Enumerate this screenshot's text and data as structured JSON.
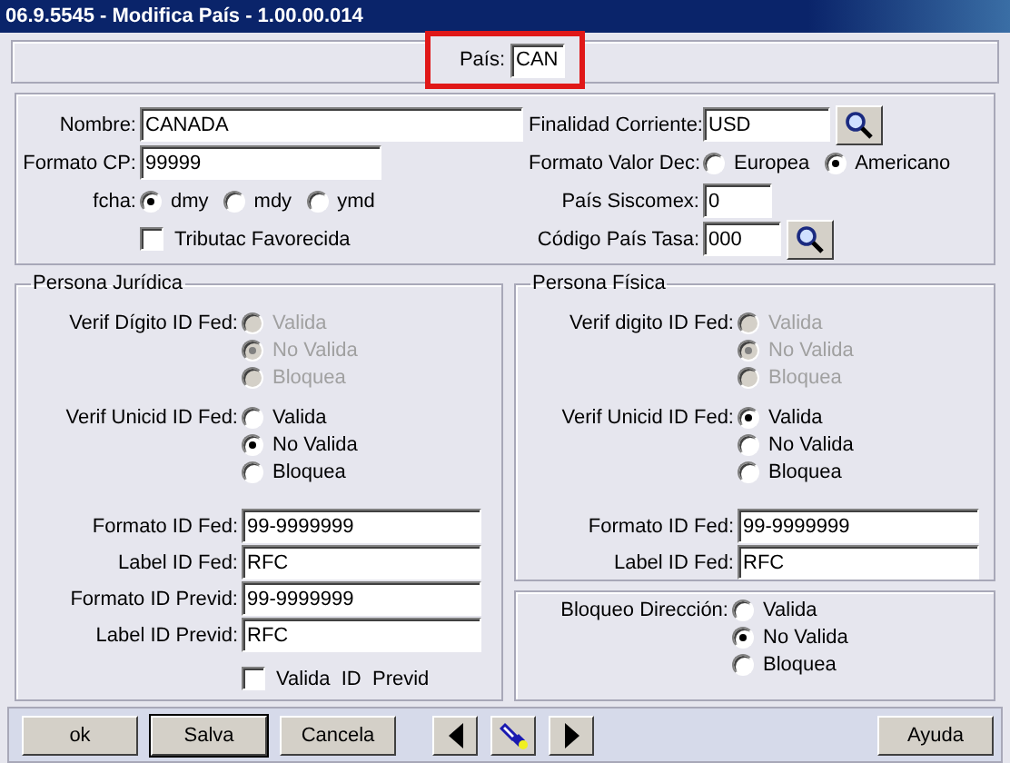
{
  "window": {
    "title": "06.9.5545 - Modifica País - 1.00.00.014"
  },
  "pais": {
    "label": "País:",
    "value": "CAN",
    "highlighted": true
  },
  "general": {
    "nombre": {
      "label": "Nombre:",
      "value": "CANADA"
    },
    "formato_cp": {
      "label": "Formato CP:",
      "value": "99999"
    },
    "fecha": {
      "label": "fcha:",
      "disabled": false,
      "options": [
        {
          "label": "dmy",
          "selected": true
        },
        {
          "label": "mdy",
          "selected": false
        },
        {
          "label": "ymd",
          "selected": false
        }
      ]
    },
    "tributac": {
      "label": "Tributac Favorecida",
      "checked": false
    },
    "finalidad": {
      "label": "Finalidad Corriente:",
      "value": "USD"
    },
    "formato_valor": {
      "label": "Formato Valor Dec:",
      "disabled": false,
      "options": [
        {
          "label": "Europea",
          "selected": false
        },
        {
          "label": "Americano",
          "selected": true
        }
      ]
    },
    "siscomex": {
      "label": "País Siscomex:",
      "value": "0"
    },
    "codigo_tasa": {
      "label": "Código País Tasa:",
      "value": "000"
    }
  },
  "juridica": {
    "title": "Persona Jurídica",
    "verif_digito": {
      "label": "Verif Dígito ID Fed:",
      "disabled": true,
      "options": [
        {
          "label": "Valida",
          "selected": false
        },
        {
          "label": "No Valida",
          "selected": true
        },
        {
          "label": "Bloquea",
          "selected": false
        }
      ]
    },
    "verif_unicid": {
      "label": "Verif Unicid ID Fed:",
      "disabled": false,
      "options": [
        {
          "label": "Valida",
          "selected": false
        },
        {
          "label": "No Valida",
          "selected": true
        },
        {
          "label": "Bloquea",
          "selected": false
        }
      ]
    },
    "fields": [
      {
        "label": "Formato ID Fed:",
        "value": "99-9999999"
      },
      {
        "label": "Label ID Fed:",
        "value": "RFC"
      },
      {
        "label": "Formato ID Previd:",
        "value": "99-9999999"
      },
      {
        "label": "Label ID Previd:",
        "value": "RFC"
      }
    ],
    "valida_previd": {
      "label": "Valida  ID  Previd",
      "checked": false
    }
  },
  "fisica": {
    "title": "Persona Física",
    "verif_digito": {
      "label": "Verif digito ID Fed:",
      "disabled": true,
      "options": [
        {
          "label": "Valida",
          "selected": false
        },
        {
          "label": "No Valida",
          "selected": true
        },
        {
          "label": "Bloquea",
          "selected": false
        }
      ]
    },
    "verif_unicid": {
      "label": "Verif Unicid ID Fed:",
      "disabled": false,
      "options": [
        {
          "label": "Valida",
          "selected": true
        },
        {
          "label": "No Valida",
          "selected": false
        },
        {
          "label": "Bloquea",
          "selected": false
        }
      ]
    },
    "fields": [
      {
        "label": "Formato ID Fed:",
        "value": "99-9999999"
      },
      {
        "label": "Label ID Fed:",
        "value": "RFC"
      }
    ]
  },
  "bloqueo": {
    "label": "Bloqueo Dirección:",
    "disabled": false,
    "options": [
      {
        "label": "Valida",
        "selected": false
      },
      {
        "label": "No Valida",
        "selected": true
      },
      {
        "label": "Bloquea",
        "selected": false
      }
    ]
  },
  "buttons": [
    {
      "kind": "text",
      "label": "ok",
      "default": false
    },
    {
      "kind": "text",
      "label": "Salva",
      "default": true
    },
    {
      "kind": "text",
      "label": "Cancela",
      "default": false
    },
    {
      "kind": "prev",
      "default": false
    },
    {
      "kind": "lookup",
      "default": false
    },
    {
      "kind": "next",
      "default": false
    },
    {
      "kind": "text",
      "label": "Ayuda",
      "default": false
    }
  ]
}
